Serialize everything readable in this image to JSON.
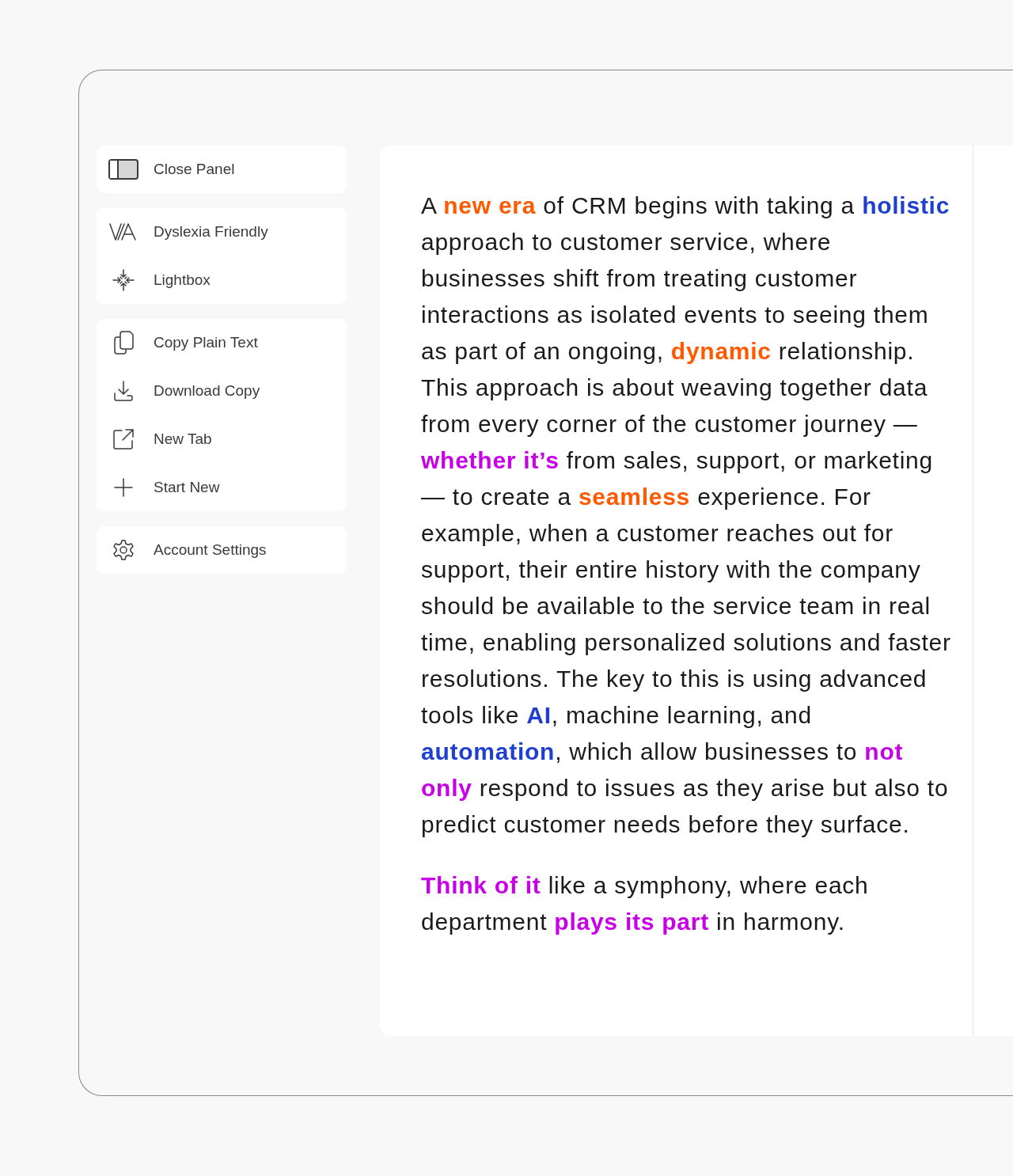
{
  "sidebar": {
    "groups": [
      {
        "items": [
          {
            "label": "Close Panel"
          }
        ]
      },
      {
        "items": [
          {
            "label": "Dyslexia Friendly"
          },
          {
            "label": "Lightbox"
          }
        ]
      },
      {
        "items": [
          {
            "label": "Copy Plain Text"
          },
          {
            "label": "Download Copy"
          },
          {
            "label": "New Tab"
          },
          {
            "label": "Start New"
          }
        ]
      },
      {
        "items": [
          {
            "label": "Account Settings"
          }
        ]
      }
    ]
  },
  "article": {
    "paragraphs": [
      {
        "runs": [
          {
            "text": "A "
          },
          {
            "text": "new era",
            "color": "#ff5a00"
          },
          {
            "text": " of CRM begins with taking a "
          },
          {
            "text": "holistic",
            "color": "#1f3fd1"
          },
          {
            "text": " approach to customer service, where businesses shift from treating customer interactions as isolated events to seeing them as part of an ongoing, "
          },
          {
            "text": "dynamic",
            "color": "#ff5a00"
          },
          {
            "text": " relationship. This approach is about weaving together data from every corner of the customer journey — "
          },
          {
            "text": "whether it’s",
            "color": "#c800e8"
          },
          {
            "text": " from sales, support, or marketing — to create a "
          },
          {
            "text": "seamless",
            "color": "#ff5a00"
          },
          {
            "text": " experience. For example, when a customer reaches out for support, their entire history with the company should be available to the service team in real time, enabling personalized solutions and faster resolutions. The key to this is using advanced tools like "
          },
          {
            "text": "AI",
            "color": "#1f3fd1"
          },
          {
            "text": ", machine learning, and "
          },
          {
            "text": "automation",
            "color": "#1f3fd1"
          },
          {
            "text": ", which allow businesses to "
          },
          {
            "text": "not only",
            "color": "#c800e8"
          },
          {
            "text": " respond to issues as they arise but also to predict customer needs before they surface."
          }
        ]
      },
      {
        "runs": [
          {
            "text": "Think of it",
            "color": "#c800e8"
          },
          {
            "text": " like a symphony, where each department "
          },
          {
            "text": "plays its part",
            "color": "#c800e8"
          },
          {
            "text": " in harmony."
          }
        ]
      }
    ]
  }
}
